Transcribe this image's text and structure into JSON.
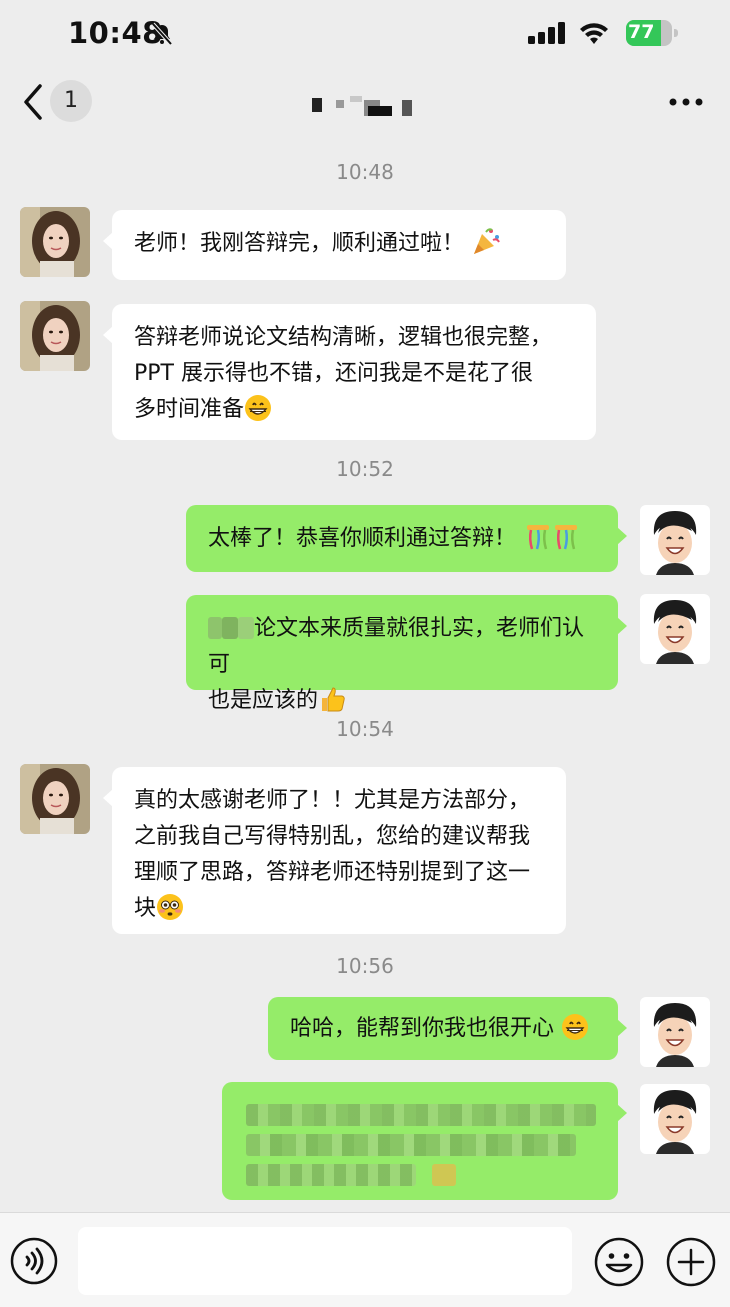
{
  "status_bar": {
    "time": "10:48",
    "battery": "77",
    "battery_level": 0.77
  },
  "nav": {
    "unread_count": "1",
    "title_obscured": true
  },
  "colors": {
    "background": "#ededed",
    "sent_bubble": "#95ec69",
    "received_bubble": "#ffffff",
    "battery_green": "#34c759"
  },
  "chat": {
    "t1": "10:48",
    "m1": "老师！我刚答辩完，顺利通过啦！",
    "m2_l1": "答辩老师说论文结构清晰，逻辑也很完整，",
    "m2_l2": "PPT 展示得也不错，还问我是不是花了很",
    "m2_l3": "多时间准备",
    "t2": "10:52",
    "m3": "太棒了！恭喜你顺利通过答辩！",
    "m4_l1": "论文本来质量就很扎实，老师们认可",
    "m4_l2": "也是应该的",
    "t3": "10:54",
    "m5_l1": "真的太感谢老师了！！尤其是方法部分，",
    "m5_l2": "之前我自己写得特别乱，您给的建议帮我",
    "m5_l3": "理顺了思路，答辩老师还特别提到了这一",
    "m5_l4": "块",
    "t4": "10:56",
    "m6": "哈哈，能帮到你我也很开心"
  },
  "icons": {
    "back": "chevron-left-icon",
    "more": "ellipsis-icon",
    "mute": "bell-slash-icon",
    "voice": "voice-icon",
    "emoji": "smiley-icon",
    "plus": "plus-icon"
  }
}
